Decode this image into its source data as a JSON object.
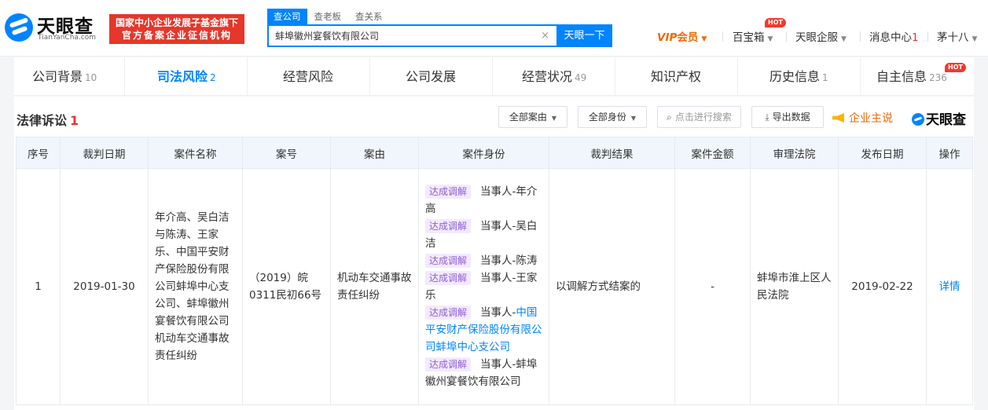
{
  "header": {
    "brand_cn": "天眼查",
    "brand_en": "TianYanCha.com",
    "slogan_line1": "国家中小企业发展子基金旗下",
    "slogan_line2": "官方备案企业征信机构",
    "search_tabs": [
      "查公司",
      "查老板",
      "查关系"
    ],
    "search_value": "蚌埠徽州宴餐饮有限公司",
    "search_button": "天眼一下",
    "clear_icon": "×",
    "nav": {
      "vip_v": "VIP",
      "vip_text": "会员",
      "baibaoxiang": "百宝箱",
      "hot": "HOT",
      "tianyan_qifu": "天眼企服",
      "message_center": "消息中心",
      "message_count": "1",
      "user": "茅十八"
    }
  },
  "tabs": [
    {
      "label": "公司背景",
      "count": "10"
    },
    {
      "label": "司法风险",
      "count": "2"
    },
    {
      "label": "经营风险",
      "count": ""
    },
    {
      "label": "公司发展",
      "count": ""
    },
    {
      "label": "经营状况",
      "count": "49"
    },
    {
      "label": "知识产权",
      "count": ""
    },
    {
      "label": "历史信息",
      "count": "1"
    },
    {
      "label": "自主信息",
      "count": "236"
    }
  ],
  "tabs_hot_badge": "HOT",
  "section": {
    "title": "法律诉讼",
    "count": "1",
    "filter_case_reason": "全部案由",
    "filter_identity": "全部身份",
    "search_placeholder": "点击进行搜索",
    "export_label": "导出数据",
    "promo_label": "企业主说",
    "mini_logo": "天眼查"
  },
  "table": {
    "headers": [
      "序号",
      "裁判日期",
      "案件名称",
      "案号",
      "案由",
      "案件身份",
      "裁判结果",
      "案件金额",
      "审理法院",
      "发布日期",
      "操作"
    ],
    "row": {
      "index": "1",
      "judgment_date": "2019-01-30",
      "case_name": "年介高、吴白洁与陈涛、王家乐、中国平安财产保险股份有限公司蚌埠中心支公司、蚌埠徽州宴餐饮有限公司机动车交通事故责任纠纷",
      "case_no": "（2019）皖0311民初66号",
      "case_reason": "机动车交通事故责任纠纷",
      "roles": [
        {
          "tag": "达成调解",
          "prefix": "当事人-",
          "name": "年介高",
          "link": false
        },
        {
          "tag": "达成调解",
          "prefix": "当事人-",
          "name": "吴白洁",
          "link": false
        },
        {
          "tag": "达成调解",
          "prefix": "当事人-",
          "name": "陈涛",
          "link": false
        },
        {
          "tag": "达成调解",
          "prefix": "当事人-",
          "name": "王家乐",
          "link": false
        },
        {
          "tag": "达成调解",
          "prefix": "当事人-",
          "name": "中国平安财产保险股份有限公司蚌埠中心支公司",
          "link": true
        },
        {
          "tag": "达成调解",
          "prefix": "当事人-",
          "name": "蚌埠徽州宴餐饮有限公司",
          "link": false
        }
      ],
      "result": "以调解方式结案的",
      "amount": "-",
      "court": "蚌埠市淮上区人民法院",
      "publish_date": "2019-02-22",
      "action": "详情"
    }
  }
}
